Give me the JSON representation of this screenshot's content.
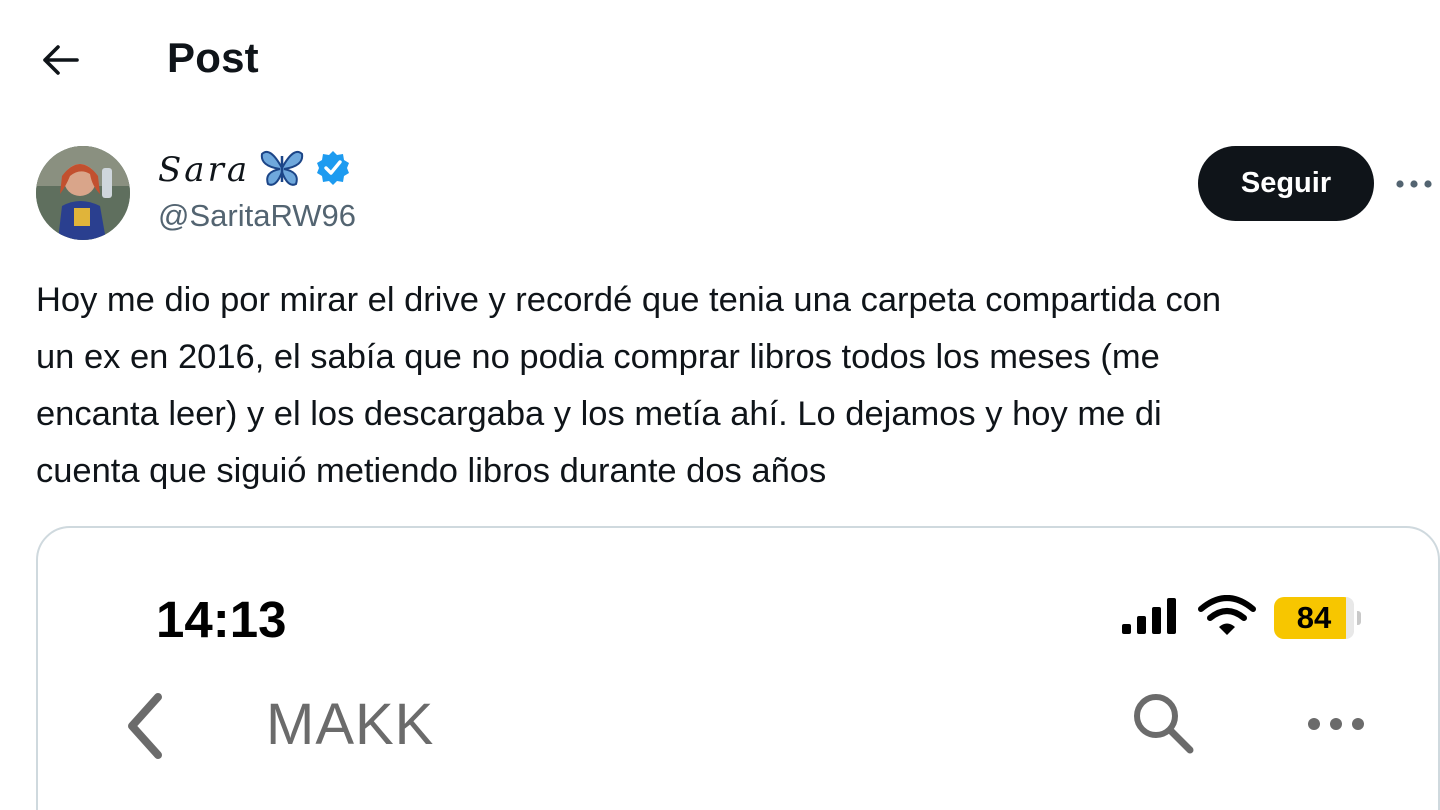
{
  "header": {
    "back_icon": "arrow-left-icon",
    "title": "Post"
  },
  "author": {
    "avatar_icon": "profile-photo",
    "name": "Sara",
    "name_emoji_icon": "butterfly-icon",
    "verified_icon": "verified-badge-icon",
    "handle": "@SaritaRW96",
    "follow_label": "Seguir",
    "more_icon": "more-horizontal-icon"
  },
  "tweet": {
    "text": "Hoy me dio por mirar el drive y recordé que tenia una carpeta compartida con\nun ex en 2016, el sabía que no podia comprar libros todos los meses (me\nencanta leer) y el los descargaba y los metía ahí. Lo dejamos y hoy me di\ncuenta que siguió metiendo libros durante dos años"
  },
  "media": {
    "status_bar": {
      "time": "14:13",
      "signal_icon": "cellular-signal-icon",
      "wifi_icon": "wifi-icon",
      "battery_level": "84"
    },
    "nav": {
      "back_icon": "chevron-left-icon",
      "title": "MAKK",
      "search_icon": "search-icon",
      "more_icon": "more-horizontal-icon"
    }
  },
  "colors": {
    "text_primary": "#0f1419",
    "text_secondary": "#536471",
    "verified_blue": "#1d9bf0",
    "follow_button_bg": "#0f1419",
    "battery_yellow": "#f7c600",
    "card_border": "#cfd9de"
  }
}
